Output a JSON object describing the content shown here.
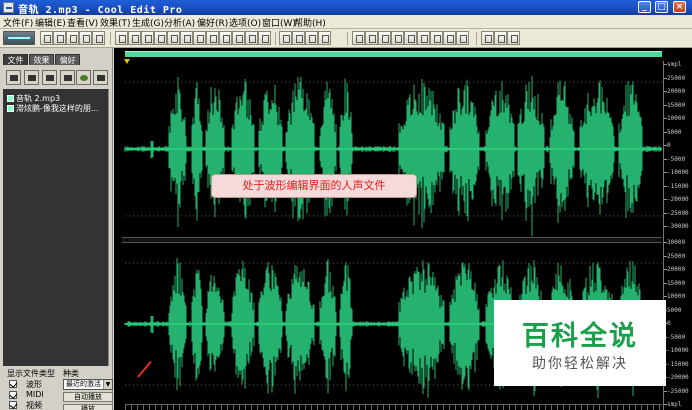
{
  "window": {
    "title": "音轨   2.mp3 - Cool Edit Pro",
    "buttons": {
      "minimize": "_",
      "maximize": "□",
      "close": "×"
    }
  },
  "menu": [
    "文件(F)",
    "编辑(E)",
    "查看(V)",
    "效果(T)",
    "生成(G)",
    "分析(A)",
    "偏好(R)",
    "选项(O)",
    "窗口(W)",
    "帮助(H)"
  ],
  "left_panel": {
    "tabs": [
      "文件",
      "效果",
      "偏好"
    ],
    "files": [
      "音轨   2.mp3",
      "滞炫鹏-像我这样的朋..."
    ],
    "show_file_types_label": "显示文件类型",
    "sort_label": "种类",
    "file_types": [
      "波形",
      "MIDI",
      "视频"
    ],
    "sort_value": "最近的激活",
    "buttons": [
      "自动播放",
      "播放"
    ]
  },
  "waveform": {
    "unit_label": "smpl",
    "scale_top": [
      "smpl",
      "25000",
      "20000",
      "15000",
      "10000",
      "5000",
      "0",
      "-5000",
      "-10000",
      "-15000",
      "-20000",
      "-25000",
      "-30000"
    ],
    "scale_bottom": [
      "30000",
      "25000",
      "20000",
      "15000",
      "10000",
      "5000",
      "0",
      "-5000",
      "-10000",
      "-15000",
      "-20000",
      "-25000",
      "smpl"
    ],
    "annotation": "处于波形编辑界面的人声文件",
    "colors": {
      "wave": "#2fe08a",
      "background": "#000000",
      "ruler": "#4ed99a",
      "annotation_text": "#e0201a"
    }
  },
  "watermark": {
    "main": "百科全说",
    "sub": "助你轻松解决"
  }
}
